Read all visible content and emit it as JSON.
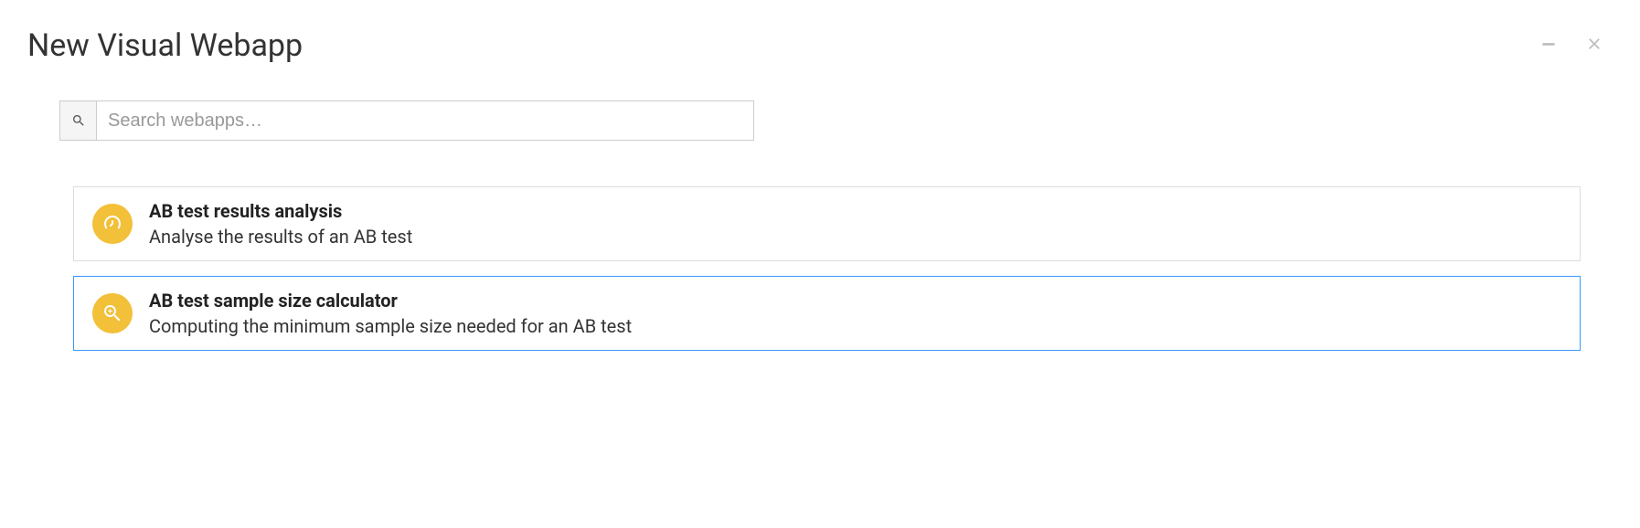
{
  "dialog": {
    "title": "New Visual Webapp"
  },
  "search": {
    "placeholder": "Search webapps…",
    "value": ""
  },
  "webapps": [
    {
      "icon": "dashboard-icon",
      "title": "AB test results analysis",
      "description": "Analyse the results of an AB test",
      "selected": false
    },
    {
      "icon": "zoom-in-icon",
      "title": "AB test sample size calculator",
      "description": "Computing the minimum sample size needed for an AB test",
      "selected": true
    }
  ],
  "colors": {
    "icon_bg": "#f2c039",
    "selected_border": "#3b99fc"
  }
}
